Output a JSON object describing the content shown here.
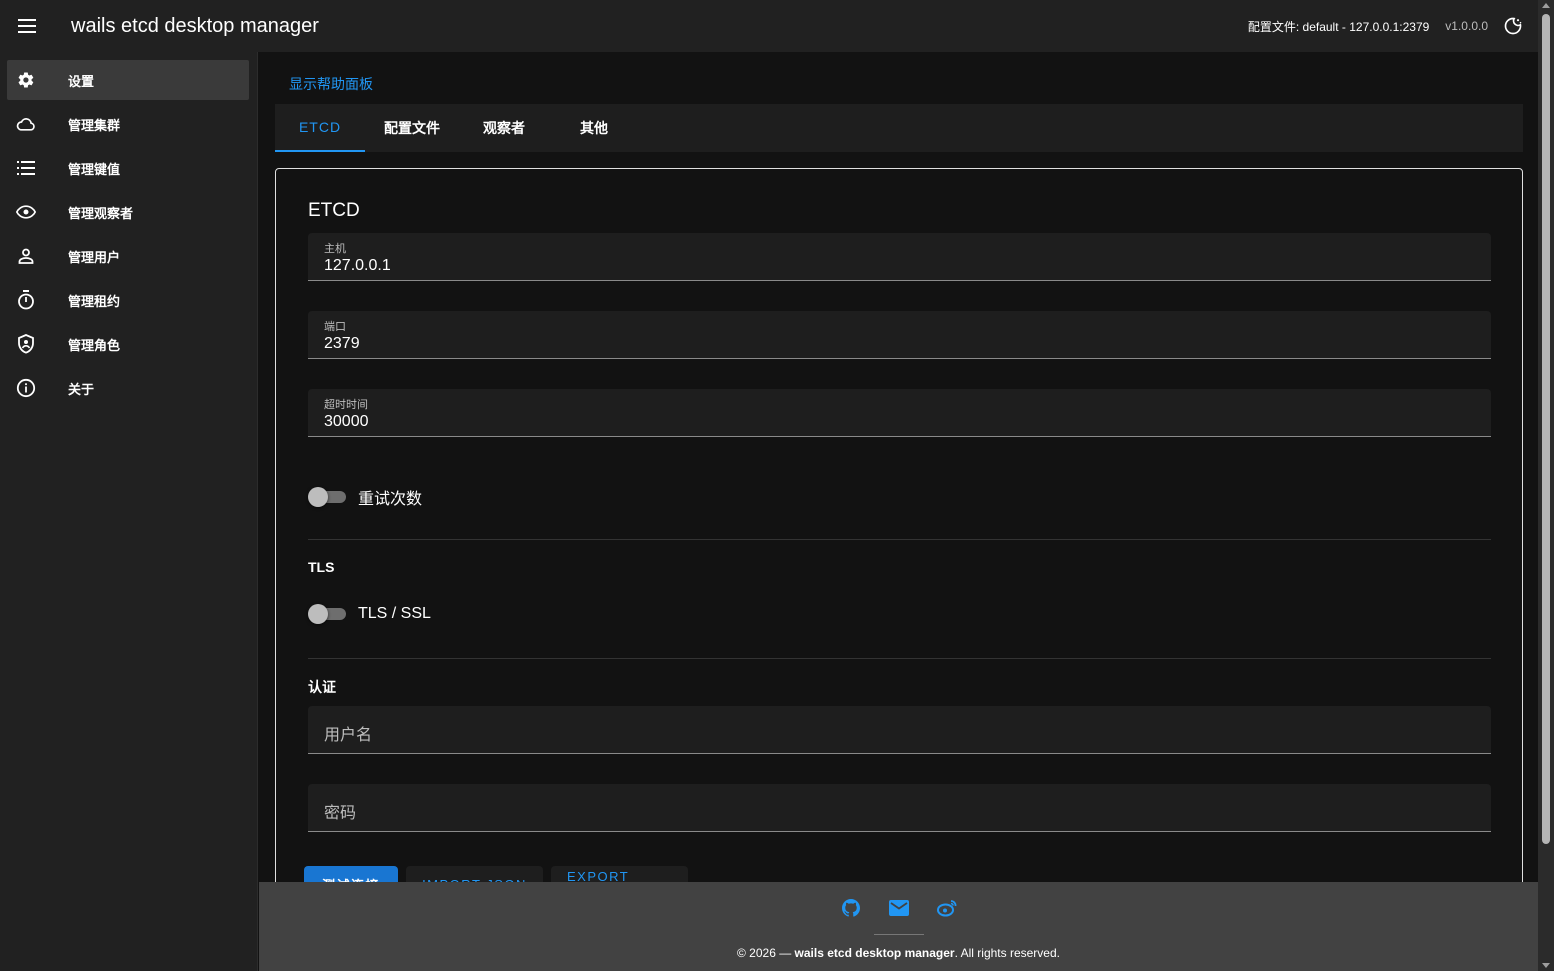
{
  "app": {
    "title": "wails etcd desktop manager",
    "profile": "配置文件: default - 127.0.0.1:2379",
    "version": "v1.0.0.0"
  },
  "sidebar": {
    "items": [
      {
        "label": "设置",
        "icon": "gear-icon",
        "active": true
      },
      {
        "label": "管理集群",
        "icon": "cloud-icon"
      },
      {
        "label": "管理键值",
        "icon": "list-icon"
      },
      {
        "label": "管理观察者",
        "icon": "eye-icon"
      },
      {
        "label": "管理用户",
        "icon": "user-icon"
      },
      {
        "label": "管理租约",
        "icon": "timer-icon"
      },
      {
        "label": "管理角色",
        "icon": "shield-icon"
      },
      {
        "label": "关于",
        "icon": "info-icon"
      }
    ]
  },
  "main": {
    "help_link": "显示帮助面板",
    "tabs": [
      {
        "label": "ETCD",
        "active": true
      },
      {
        "label": "配置文件"
      },
      {
        "label": "观察者"
      },
      {
        "label": "其他"
      }
    ]
  },
  "form": {
    "title": "ETCD",
    "host": {
      "label": "主机",
      "value": "127.0.0.1"
    },
    "port": {
      "label": "端口",
      "value": "2379"
    },
    "timeout": {
      "label": "超时时间",
      "value": "30000"
    },
    "retry_label": "重试次数",
    "tls_section": "TLS",
    "tls_label": "TLS / SSL",
    "auth_section": "认证",
    "username_placeholder": "用户名",
    "password_placeholder": "密码",
    "buttons": {
      "test": "测试连接",
      "import": "IMPORT JSON",
      "export": "EXPORT JSON"
    }
  },
  "footer": {
    "icons": [
      "github-icon",
      "mail-icon",
      "weibo-icon"
    ],
    "copy_prefix": "© 2026 — ",
    "copy_app": "wails etcd desktop manager",
    "copy_suffix": ". All rights reserved."
  },
  "colors": {
    "accent": "#2196f3",
    "primary_button": "#1976d2",
    "appbar": "#212121",
    "background": "#121212"
  }
}
